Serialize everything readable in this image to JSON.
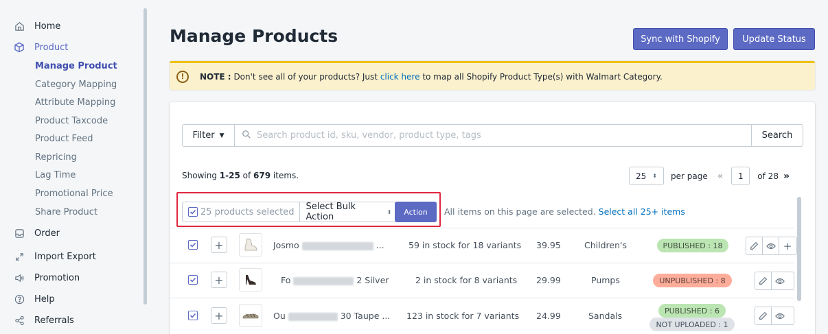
{
  "sidebar": {
    "home": "Home",
    "product": "Product",
    "sub_items": [
      "Manage Product",
      "Category Mapping",
      "Attribute Mapping",
      "Product Taxcode",
      "Product Feed",
      "Repricing",
      "Lag Time",
      "Promotional Price",
      "Share Product"
    ],
    "order": "Order",
    "import_export": "Import Export",
    "promotion": "Promotion",
    "help": "Help",
    "referrals": "Referrals"
  },
  "header": {
    "title": "Manage Products",
    "sync_button": "Sync with Shopify",
    "update_button": "Update Status"
  },
  "note": {
    "label": "NOTE :",
    "text_before": "Don't see all of your products? Just",
    "link": "click here",
    "text_after": "to map all Shopify Product Type(s) with Walmart Category."
  },
  "search": {
    "filter_label": "Filter",
    "placeholder": "Search product id, sku, vendor, product type, tags",
    "button": "Search"
  },
  "listing": {
    "showing_prefix": "Showing",
    "range": "1-25",
    "of": "of",
    "total": "679",
    "suffix": "items.",
    "per_page_value": "25",
    "per_page_label": "per page",
    "page_value": "1",
    "of_pages": "of 28",
    "prev": "«",
    "next": "»"
  },
  "bulk": {
    "selected_text": "25 products selected",
    "bulk_action": "Select Bulk Action",
    "action_button": "Action",
    "all_selected_text": "All items on this page are selected.",
    "select_all_link": "Select all 25+ items"
  },
  "rows": [
    {
      "title_start": "Josmo",
      "title_end": "...",
      "stock": "59 in stock for 18 variants",
      "price": "39.95",
      "type": "Children's",
      "badges": [
        "PUBLISHED : 18"
      ]
    },
    {
      "title_start": "Fo",
      "title_end": "2 Silver",
      "stock": "2 in stock for 8 variants",
      "price": "29.99",
      "type": "Pumps",
      "badges": [
        "UNPUBLISHED : 8"
      ]
    },
    {
      "title_start": "Ou",
      "title_end": "30 Taupe ...",
      "stock": "123 in stock for 7 variants",
      "price": "24.99",
      "type": "Sandals",
      "badges": [
        "PUBLISHED : 6",
        "NOT UPLOADED : 1"
      ]
    }
  ],
  "colors": {
    "primary": "#5c6ac4",
    "highlight": "#e0263f",
    "published": "#bbe5b3",
    "unpublished": "#fead9a"
  }
}
